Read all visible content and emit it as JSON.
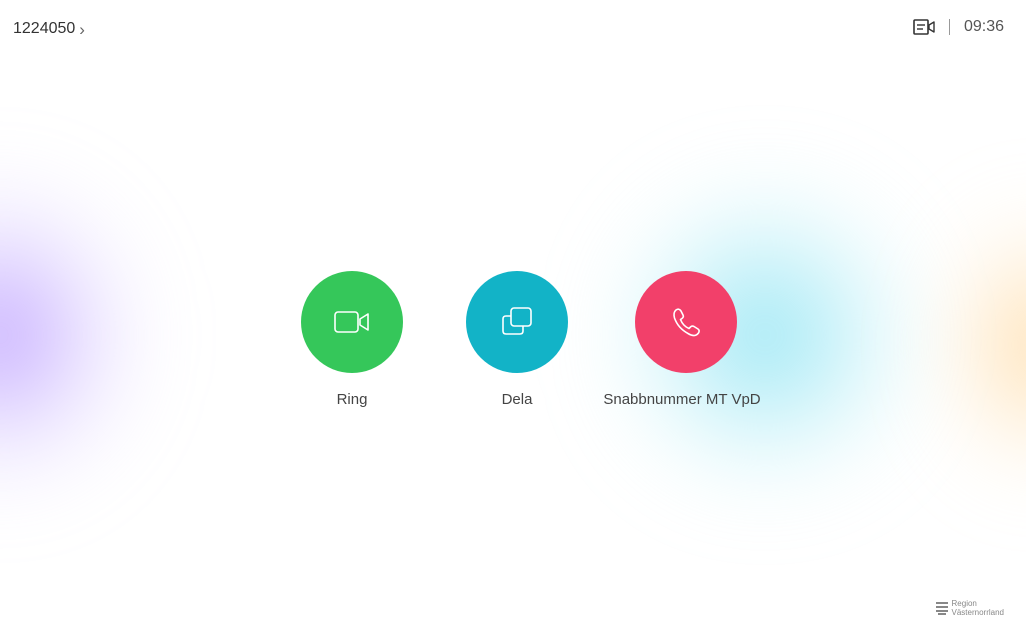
{
  "header": {
    "room_number": "1224050",
    "chevron": "›",
    "self_view_icon": "camera-selfview-icon",
    "time": "09:36"
  },
  "actions": [
    {
      "label": "Ring",
      "color": "#35c75a",
      "icon": "video-camera-icon"
    },
    {
      "label": "Dela",
      "color": "#12b3c7",
      "icon": "share-screen-icon"
    },
    {
      "label": "Snabbnummer MT VpD",
      "color": "#f2406a",
      "icon": "phone-handset-icon"
    }
  ],
  "branding": {
    "line1": "Region",
    "line2": "Västernorrland"
  }
}
